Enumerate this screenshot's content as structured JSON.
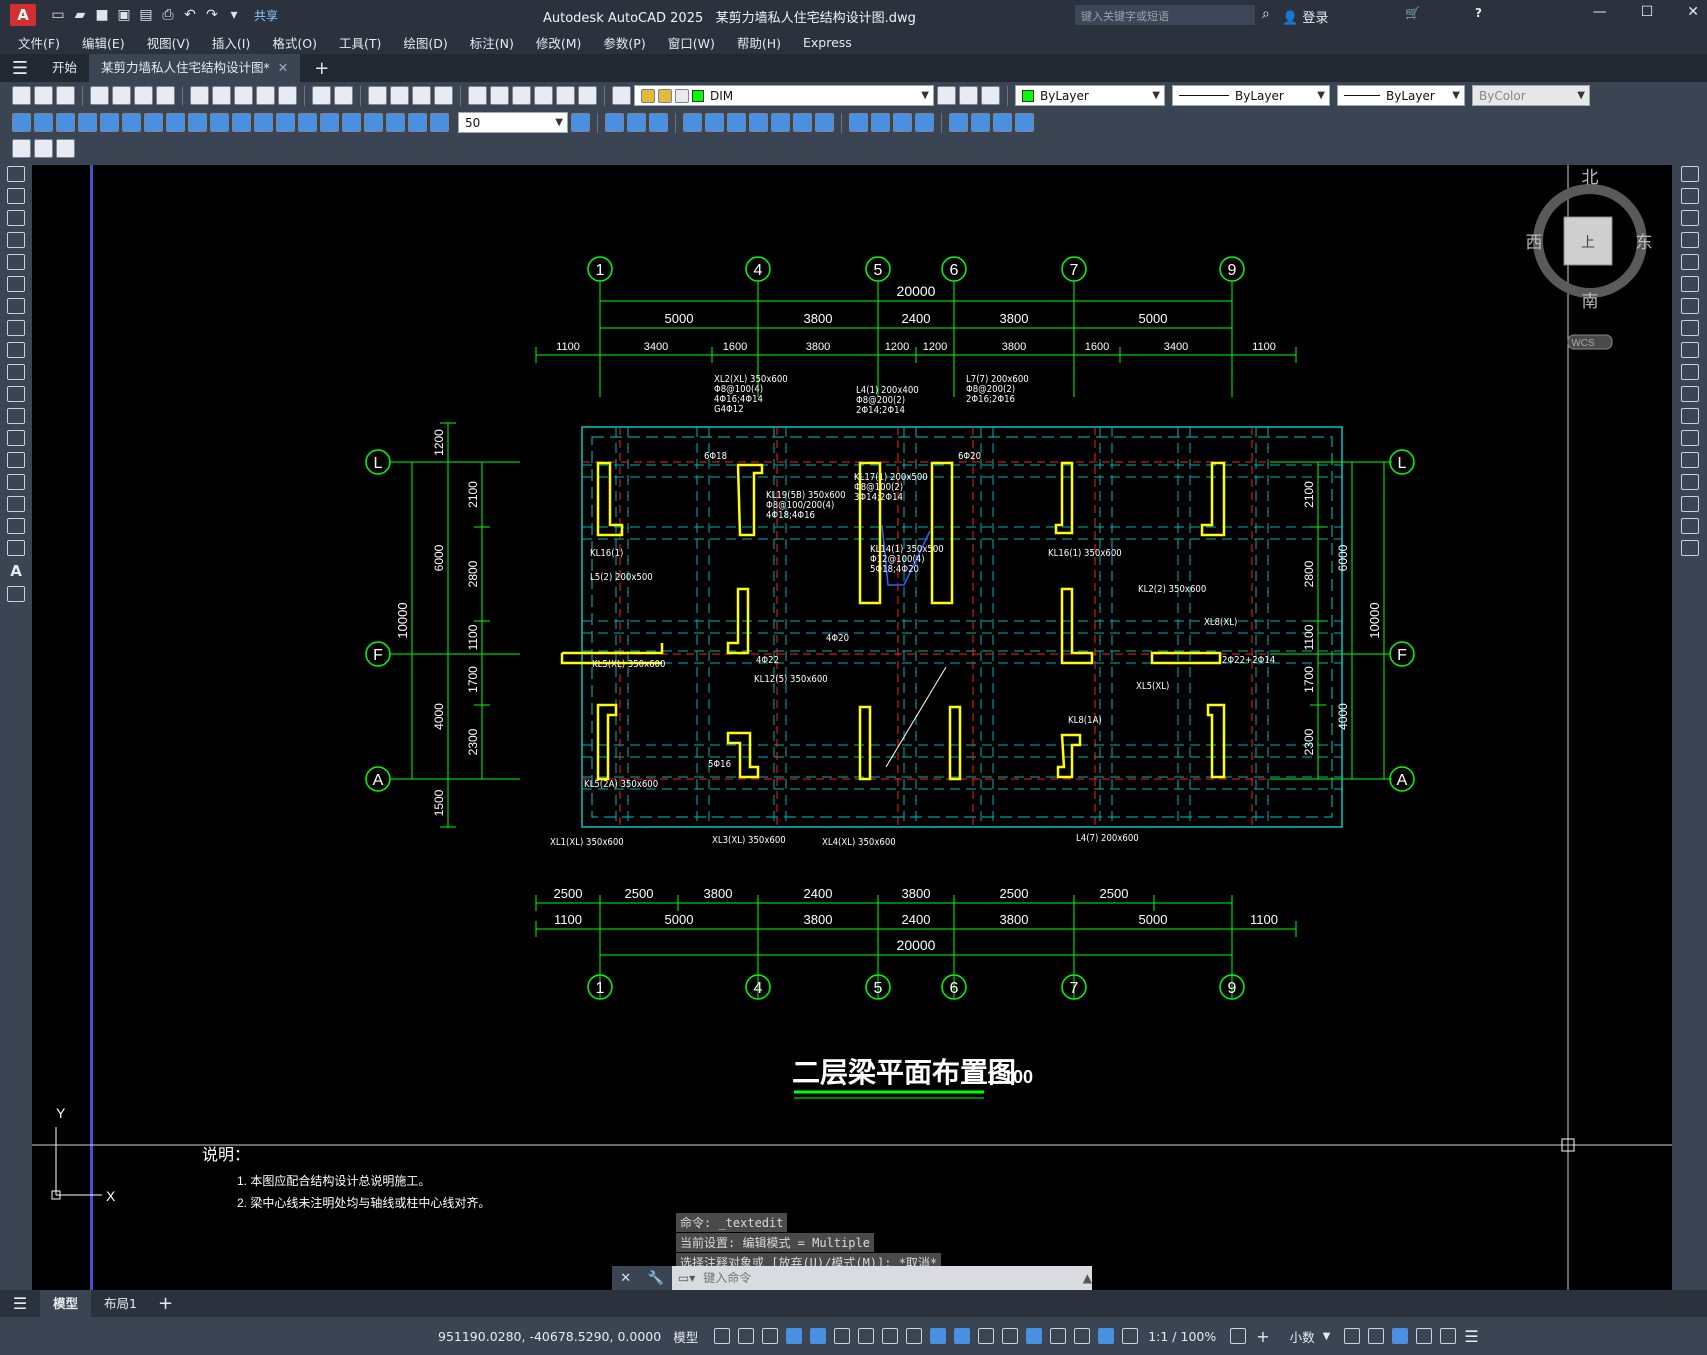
{
  "app": {
    "title": "Autodesk AutoCAD 2025",
    "file": "某剪力墙私人住宅结构设计图.dwg",
    "logo": "A",
    "share": "共享",
    "search_placeholder": "键入关键字或短语",
    "login": "登录"
  },
  "menu": [
    "文件(F)",
    "编辑(E)",
    "视图(V)",
    "插入(I)",
    "格式(O)",
    "工具(T)",
    "绘图(D)",
    "标注(N)",
    "修改(M)",
    "参数(P)",
    "窗口(W)",
    "帮助(H)",
    "Express"
  ],
  "tabs": {
    "start": "开始",
    "doc": "某剪力墙私人住宅结构设计图*"
  },
  "toolbar": {
    "layer": "DIM",
    "color": "ByLayer",
    "linetype": "ByLayer",
    "lineweight": "ByLayer",
    "plotstyle": "ByColor",
    "dimscale": "50",
    "layer_color": "#00ff00"
  },
  "viewcube": {
    "north": "北",
    "south": "南",
    "east": "东",
    "west": "西",
    "top": "上",
    "wcs": "WCS"
  },
  "drawing": {
    "title": "二层梁平面布置图",
    "scale": "1:100",
    "axes_top": [
      "1",
      "4",
      "5",
      "6",
      "7",
      "9"
    ],
    "axes_side": [
      "L",
      "F",
      "A"
    ],
    "dim_total": "20000",
    "dims_row1": [
      "5000",
      "3800",
      "2400",
      "3800",
      "5000"
    ],
    "dims_row2": [
      "1100",
      "3400",
      "1600",
      "3800",
      "1200",
      "1200",
      "3800",
      "1600",
      "3400",
      "1100"
    ],
    "dims_bottom1": [
      "2500",
      "2500",
      "3800",
      "2400",
      "3800",
      "2500",
      "2500"
    ],
    "dims_bottom2": [
      "1100",
      "5000",
      "3800",
      "2400",
      "3800",
      "5000",
      "1100"
    ],
    "left_dims_outer": [
      "1200",
      "6000",
      "10000",
      "4000",
      "1500"
    ],
    "left_dims_inner": [
      "2100",
      "2800",
      "1100",
      "1700",
      "2300"
    ],
    "right_dims_inner": [
      "2100",
      "2800",
      "1100",
      "1700",
      "2300"
    ],
    "right_dims_outer": [
      "6000",
      "10000",
      "4000"
    ],
    "notes_title": "说明：",
    "note1": "1. 本图应配合结构设计总说明施工。",
    "note2": "2. 梁中心线未注明处均与轴线或柱中心线对齐。",
    "beam_labels": [
      "XL2(XL) 350x600",
      "Φ8@100(4)",
      "4Φ16;4Φ14",
      "G4Φ12",
      "L4(1) 200x400",
      "Φ8@200(2)",
      "2Φ14;2Φ14",
      "L7(7) 200x600",
      "Φ8@200(2)",
      "2Φ16;2Φ16",
      "KL19(5B) 350x600",
      "Φ8@100/200(4)",
      "4Φ18;4Φ16",
      "KL17(1) 200x500",
      "Φ8@100(2)",
      "3Φ14;2Φ14",
      "KL14(1) 350x500",
      "Φ12@100(4)",
      "5Φ18;4Φ20",
      "KL16(1)",
      "L5(2) 200x500",
      "KL5(XL) 350x600",
      "KL12(5) 350x600",
      "KL5(2A) 350x600",
      "XL1(XL) 350x600",
      "XL3(XL) 350x600",
      "XL4(XL) 350x600",
      "L4(7) 200x600",
      "KL16(1) 350x600",
      "KL2(2) 350x600",
      "KL8(1A)",
      "XL5(XL)",
      "XL8(XL)",
      "6Φ18",
      "6Φ20",
      "4Φ20",
      "4Φ22",
      "2Φ22+2Φ14",
      "5Φ16",
      "3Φ14"
    ]
  },
  "commands": [
    "命令: _textedit",
    "当前设置: 编辑模式 = Multiple",
    "选择注释对象或 [放弃(U)/模式(M)]: *取消*"
  ],
  "cmd_placeholder": "键入命令",
  "layout_tabs": [
    "模型",
    "布局1"
  ],
  "status": {
    "coords": "951190.0280, -40678.5290, 0.0000",
    "space": "模型",
    "scale": "1:1 / 100%",
    "units": "小数"
  }
}
